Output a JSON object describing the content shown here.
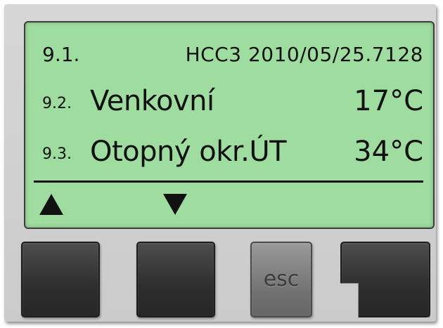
{
  "display": {
    "header": {
      "number": "9.1.",
      "identifier": "HCC3 2010/05/25.7128"
    },
    "rows": [
      {
        "number": "9.2.",
        "label": "Venkovní",
        "value": "17°C"
      },
      {
        "number": "9.3.",
        "label": "Otopný okr.ÚT",
        "value": "34°C"
      }
    ],
    "nav": {
      "up_icon": "arrow-up-icon",
      "down_icon": "arrow-down-icon"
    },
    "colors": {
      "lcd_background": "#9fdca0",
      "button_dark": "#2e2e2e",
      "button_esc": "#707070"
    }
  },
  "buttons": {
    "esc_label": "esc"
  }
}
